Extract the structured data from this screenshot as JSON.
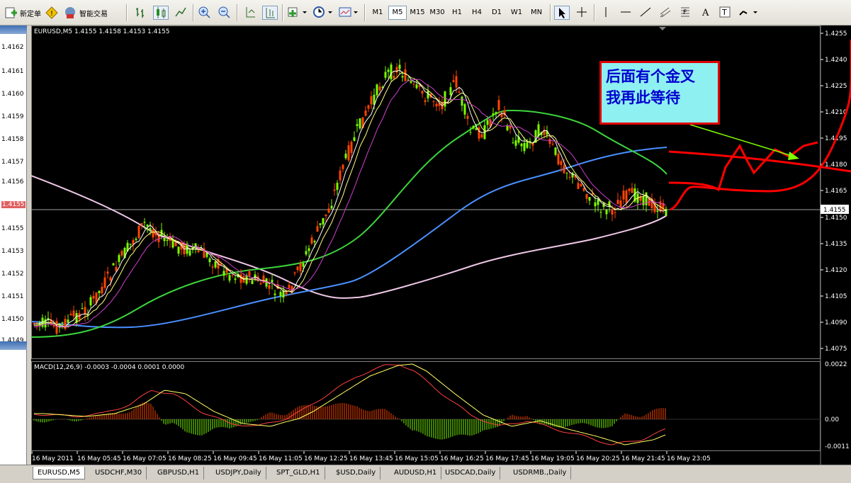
{
  "toolbar": {
    "new_order_label": "新定单",
    "expert_label": "智能交易",
    "timeframes": [
      "M1",
      "M5",
      "M15",
      "M30",
      "H1",
      "H4",
      "D1",
      "W1",
      "MN"
    ],
    "active_timeframe": "M5"
  },
  "left_panel": {
    "prices": [
      "1.4162",
      "1.4161",
      "1.4160",
      "1.4159",
      "1.4158",
      "1.4157",
      "1.4156",
      "1.4155",
      "1.4155",
      "1.4153",
      "1.4152",
      "1.4151",
      "1.4150",
      "1.4149"
    ],
    "highlight_index": 7
  },
  "chart": {
    "symbol_info": "EURUSD,M5  1.4155 1.4158 1.4153 1.4155",
    "current_price": "1.4155",
    "price_axis": [
      "1.4255",
      "1.4240",
      "1.4225",
      "1.4210",
      "1.4195",
      "1.4180",
      "1.4165",
      "1.4150",
      "1.4135",
      "1.4120",
      "1.4105",
      "1.4090",
      "1.4075"
    ],
    "macd_info": "MACD(12,26,9) -0.0003 -0.0004 0.0001 0.0000",
    "macd_axis": [
      "0.0022",
      "0.00",
      "-0.0011"
    ],
    "time_axis": [
      "16 May 2011",
      "16 May 05:45",
      "16 May 07:05",
      "16 May 08:25",
      "16 May 09:45",
      "16 May 11:05",
      "16 May 12:25",
      "16 May 13:45",
      "16 May 15:05",
      "16 May 16:25",
      "16 May 17:45",
      "16 May 19:05",
      "16 May 20:25",
      "16 May 21:45",
      "16 May 23:05"
    ]
  },
  "note": {
    "line1": "后面有个金叉",
    "line2": "我再此等待"
  },
  "tabs": [
    "EURUSD,M5",
    "USDCHF,M30",
    "GBPUSD,H1",
    "USDJPY,Daily",
    "SPT_GLD,H1",
    "$USD,Daily",
    "AUDUSD,H1",
    "USDCAD,Daily",
    "USDRMB.,Daily"
  ],
  "active_tab": "EURUSD,M5",
  "colors": {
    "bull": "#7CFC00",
    "bear": "#ff4500",
    "ma_green": "#3cd43c",
    "ma_blue": "#4a90ff",
    "ma_pink": "#f0c8e8",
    "annotation": "#ff0000"
  }
}
